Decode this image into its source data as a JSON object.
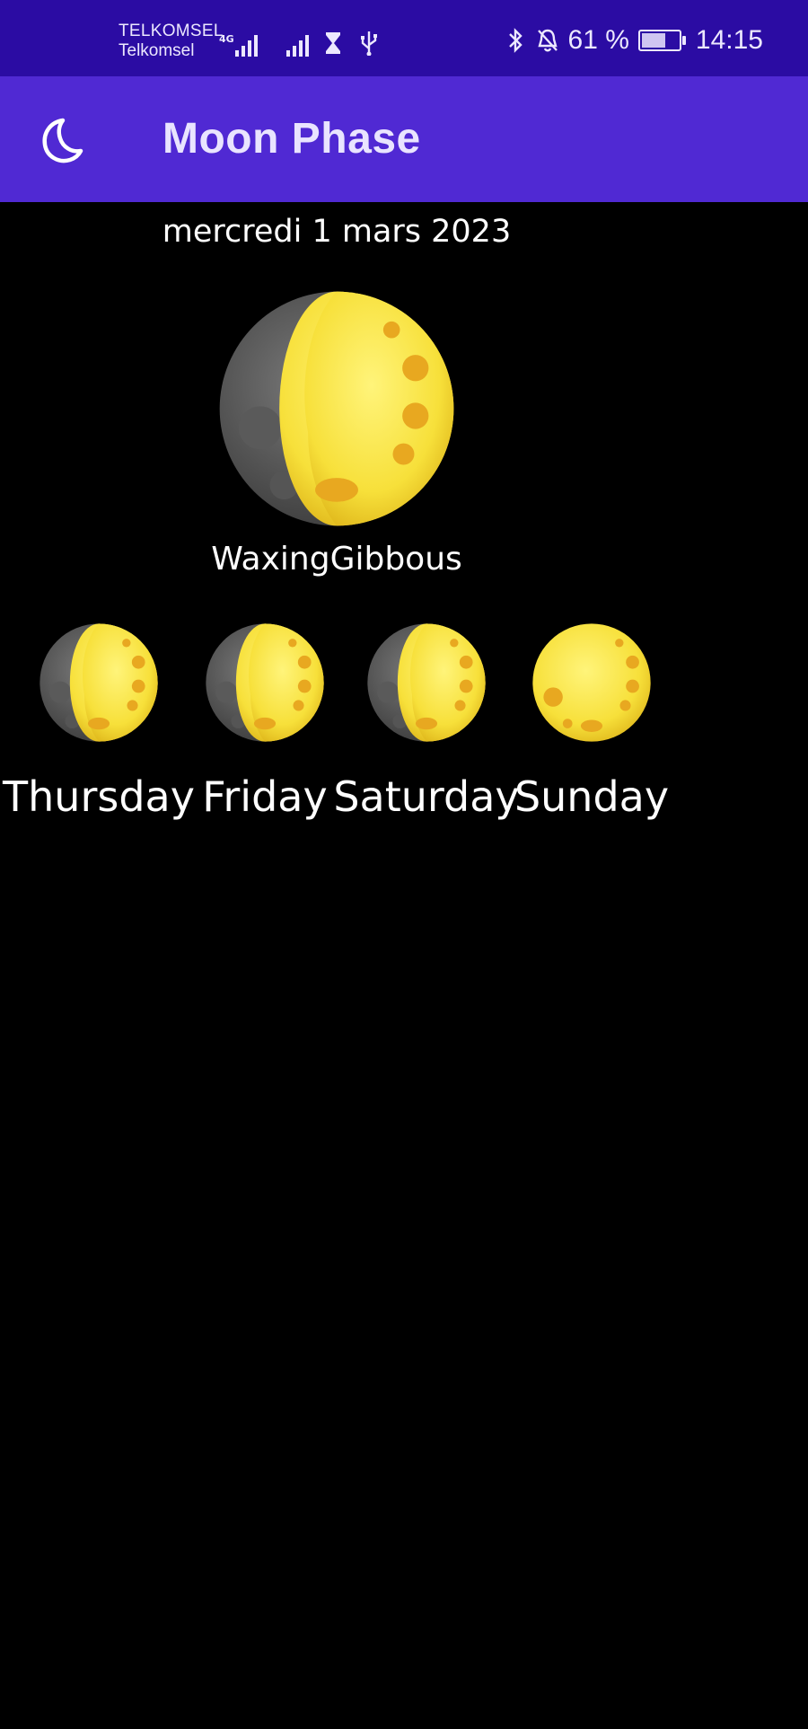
{
  "status_bar": {
    "carrier_primary": "TELKOMSEL",
    "carrier_secondary": "Telkomsel",
    "network_type": "4G",
    "battery_percent": "61 %",
    "time": "14:15"
  },
  "app_bar": {
    "title": "Moon Phase",
    "icon": "crescent-moon-icon"
  },
  "today": {
    "date": "mercredi 1 mars 2023",
    "phase": "WaxingGibbous"
  },
  "forecast": [
    {
      "day": "Thursday",
      "phase_icon": "waxing-gibbous-icon"
    },
    {
      "day": "Friday",
      "phase_icon": "waxing-gibbous-icon"
    },
    {
      "day": "Saturday",
      "phase_icon": "waxing-gibbous-icon"
    },
    {
      "day": "Sunday",
      "phase_icon": "full-moon-icon"
    }
  ],
  "colors": {
    "status_bar_bg": "#2b0ca3",
    "app_bar_bg": "#5029d3",
    "background": "#000000",
    "moon_yellow": "#ffe94a",
    "moon_shadow": "#6a6a6a"
  }
}
